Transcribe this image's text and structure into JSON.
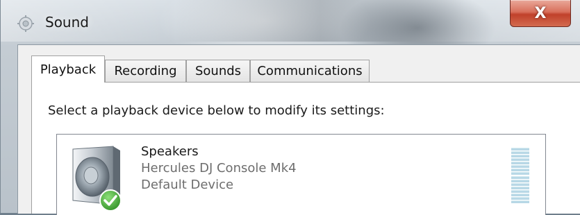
{
  "window": {
    "title": "Sound",
    "close_label": "X"
  },
  "tabs": [
    {
      "label": "Playback",
      "active": true
    },
    {
      "label": "Recording",
      "active": false
    },
    {
      "label": "Sounds",
      "active": false
    },
    {
      "label": "Communications",
      "active": false
    }
  ],
  "playback": {
    "instruction": "Select a playback device below to modify its settings:",
    "devices": [
      {
        "name": "Speakers",
        "description": "Hercules DJ Console Mk4",
        "status": "Default Device",
        "icon": "speaker-icon",
        "badge_icon": "default-check-icon"
      }
    ]
  },
  "colors": {
    "close_button": "#c94a33",
    "check_green": "#3ba52e",
    "meter": "#b8d8e6"
  }
}
